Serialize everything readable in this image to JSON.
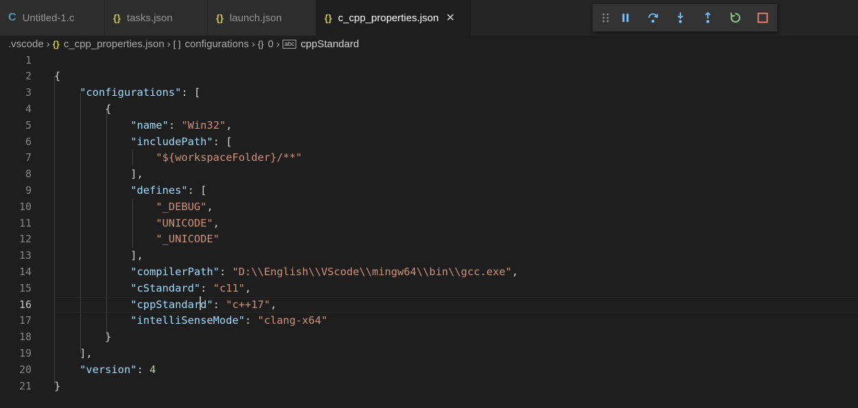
{
  "tabs": [
    {
      "icon": "C",
      "label": "Untitled-1.c",
      "active": false
    },
    {
      "icon": "{}",
      "label": "tasks.json",
      "active": false
    },
    {
      "icon": "{}",
      "label": "launch.json",
      "active": false
    },
    {
      "icon": "{}",
      "label": "c_cpp_properties.json",
      "active": true
    }
  ],
  "active_tab_close": "✕",
  "debug_toolbar": {
    "buttons": [
      "drag-grip",
      "pause",
      "step-over",
      "step-into",
      "step-out",
      "restart",
      "stop"
    ],
    "colors": {
      "pause": "#75beff",
      "step": "#75beff",
      "restart": "#89d185",
      "stop": "#f48771"
    }
  },
  "breadcrumb": {
    "folder": ".vscode",
    "file": "c_cpp_properties.json",
    "array_icon": "[ ]",
    "array": "configurations",
    "object_icon": "{}",
    "index": "0",
    "symbol_icon": "abc",
    "leaf": "cppStandard"
  },
  "editor": {
    "line_numbers": [
      "1",
      "2",
      "3",
      "4",
      "5",
      "6",
      "7",
      "8",
      "9",
      "10",
      "11",
      "12",
      "13",
      "14",
      "15",
      "16",
      "17",
      "18",
      "19",
      "20",
      "21"
    ],
    "current_line": "16",
    "lines": [
      [],
      [
        {
          "t": "p",
          "v": "{"
        }
      ],
      [
        {
          "t": "p",
          "v": "    "
        },
        {
          "t": "k",
          "v": "\"configurations\""
        },
        {
          "t": "p",
          "v": ": ["
        }
      ],
      [
        {
          "t": "p",
          "v": "        {"
        }
      ],
      [
        {
          "t": "p",
          "v": "            "
        },
        {
          "t": "k",
          "v": "\"name\""
        },
        {
          "t": "p",
          "v": ": "
        },
        {
          "t": "s",
          "v": "\"Win32\""
        },
        {
          "t": "p",
          "v": ","
        }
      ],
      [
        {
          "t": "p",
          "v": "            "
        },
        {
          "t": "k",
          "v": "\"includePath\""
        },
        {
          "t": "p",
          "v": ": ["
        }
      ],
      [
        {
          "t": "p",
          "v": "                "
        },
        {
          "t": "s",
          "v": "\"${workspaceFolder}/**\""
        }
      ],
      [
        {
          "t": "p",
          "v": "            ],"
        }
      ],
      [
        {
          "t": "p",
          "v": "            "
        },
        {
          "t": "k",
          "v": "\"defines\""
        },
        {
          "t": "p",
          "v": ": ["
        }
      ],
      [
        {
          "t": "p",
          "v": "                "
        },
        {
          "t": "s",
          "v": "\"_DEBUG\""
        },
        {
          "t": "p",
          "v": ","
        }
      ],
      [
        {
          "t": "p",
          "v": "                "
        },
        {
          "t": "s",
          "v": "\"UNICODE\""
        },
        {
          "t": "p",
          "v": ","
        }
      ],
      [
        {
          "t": "p",
          "v": "                "
        },
        {
          "t": "s",
          "v": "\"_UNICODE\""
        }
      ],
      [
        {
          "t": "p",
          "v": "            ],"
        }
      ],
      [
        {
          "t": "p",
          "v": "            "
        },
        {
          "t": "k",
          "v": "\"compilerPath\""
        },
        {
          "t": "p",
          "v": ": "
        },
        {
          "t": "s",
          "v": "\"D:\\\\English\\\\VScode\\\\mingw64\\\\bin\\\\gcc.exe\""
        },
        {
          "t": "p",
          "v": ","
        }
      ],
      [
        {
          "t": "p",
          "v": "            "
        },
        {
          "t": "k",
          "v": "\"cStandard\""
        },
        {
          "t": "p",
          "v": ": "
        },
        {
          "t": "s",
          "v": "\"c11\""
        },
        {
          "t": "p",
          "v": ","
        }
      ],
      [
        {
          "t": "p",
          "v": "            "
        },
        {
          "t": "k",
          "v": "\"cppStandard\""
        },
        {
          "t": "p",
          "v": ": "
        },
        {
          "t": "s",
          "v": "\"c++17\""
        },
        {
          "t": "p",
          "v": ","
        }
      ],
      [
        {
          "t": "p",
          "v": "            "
        },
        {
          "t": "k",
          "v": "\"intelliSenseMode\""
        },
        {
          "t": "p",
          "v": ": "
        },
        {
          "t": "s",
          "v": "\"clang-x64\""
        }
      ],
      [
        {
          "t": "p",
          "v": "        }"
        }
      ],
      [
        {
          "t": "p",
          "v": "    ],"
        }
      ],
      [
        {
          "t": "p",
          "v": "    "
        },
        {
          "t": "k",
          "v": "\"version\""
        },
        {
          "t": "p",
          "v": ": "
        },
        {
          "t": "n",
          "v": "4"
        }
      ],
      [
        {
          "t": "p",
          "v": "}"
        }
      ]
    ]
  }
}
